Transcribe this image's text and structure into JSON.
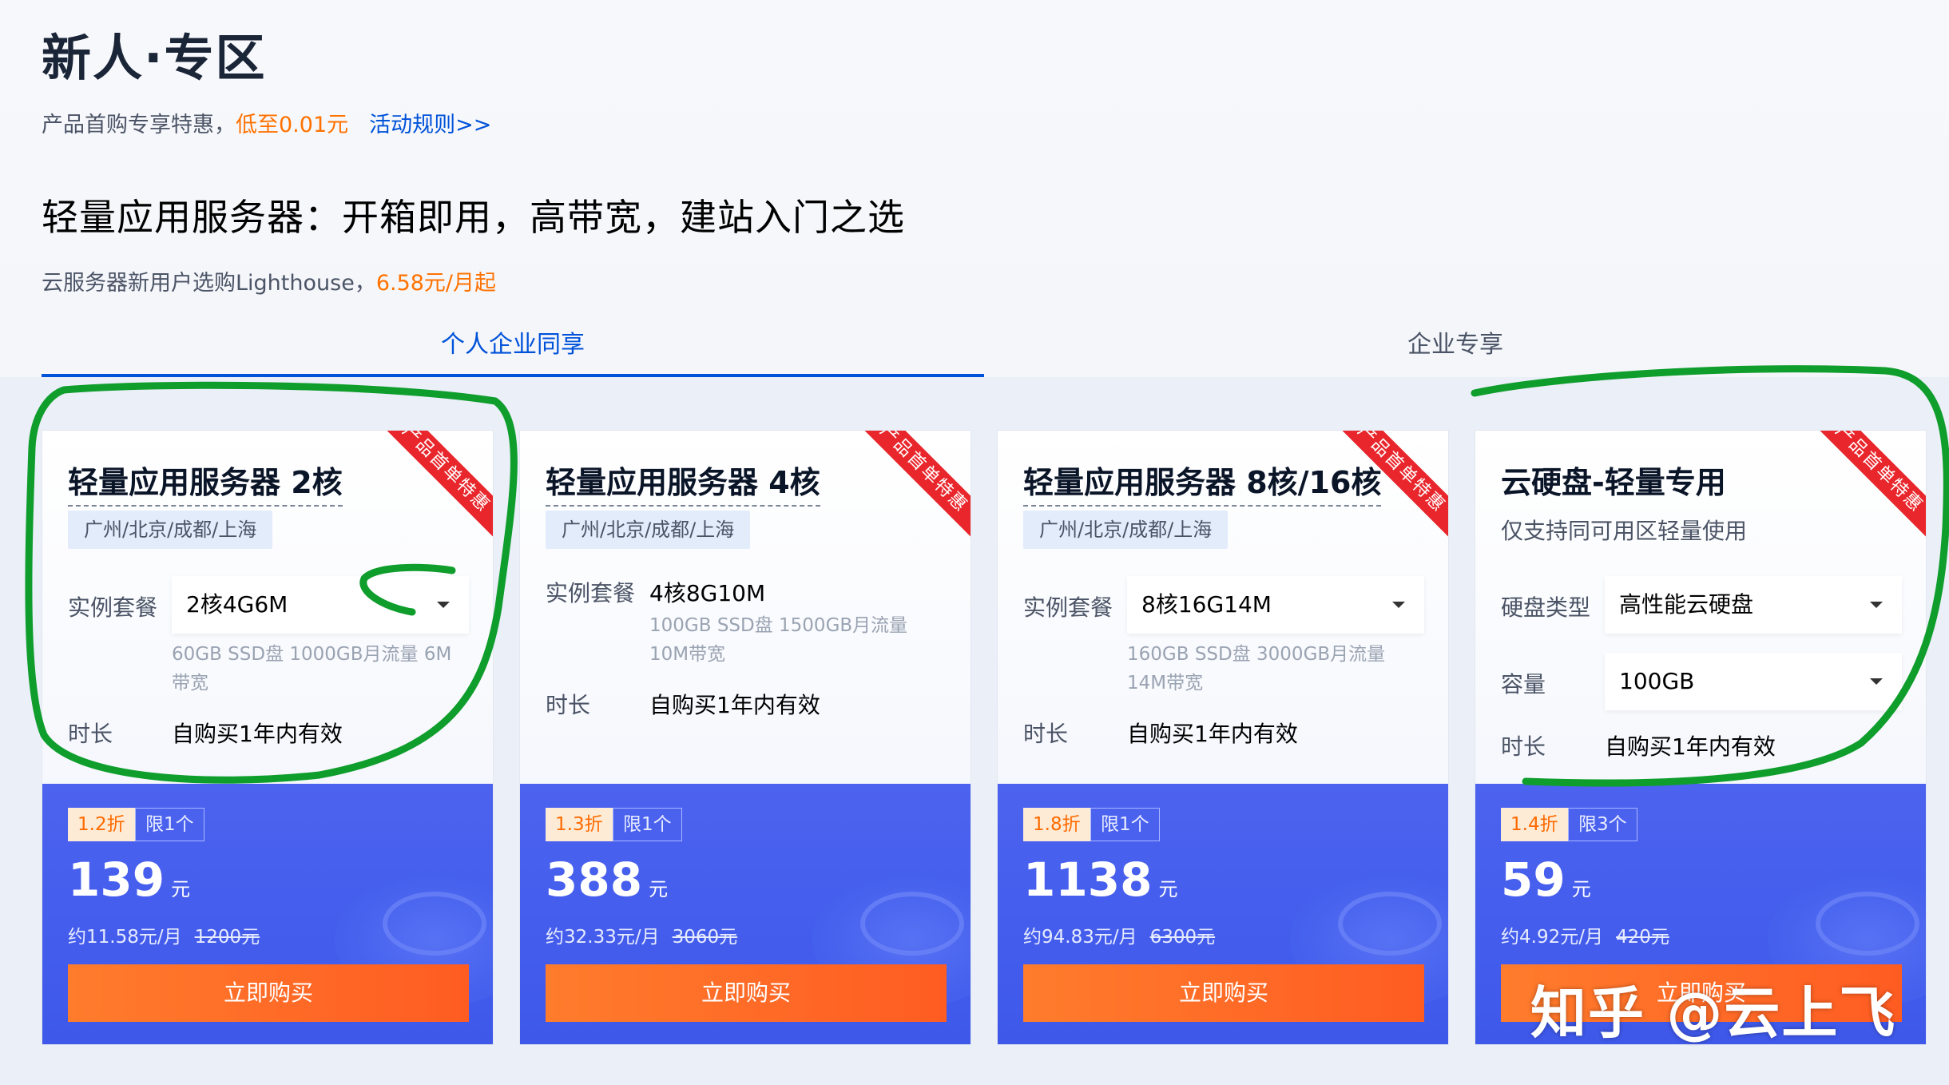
{
  "header": {
    "title": "新人·专区",
    "subtitle_prefix": "产品首购专享特惠，",
    "subtitle_highlight": "低至0.01元",
    "rules_link": "活动规则>>"
  },
  "promo": {
    "heading": "轻量应用服务器：开箱即用，高带宽，建站入门之选",
    "sub_prefix": "云服务器新用户选购Lighthouse，",
    "sub_highlight": "6.58元/月起"
  },
  "tabs": [
    {
      "label": "个人企业同享",
      "active": true
    },
    {
      "label": "企业专享",
      "active": false
    }
  ],
  "cards": [
    {
      "ribbon": "产品首单特惠",
      "title": "轻量应用服务器 2核",
      "region": "广州/北京/成都/上海",
      "package_label": "实例套餐",
      "package_value": "2核4G6M",
      "spec": "60GB SSD盘 1000GB月流量 6M带宽",
      "duration_label": "时长",
      "duration_value": "自购买1年内有效",
      "discount": "1.2折",
      "limit": "限1个",
      "price": "139",
      "price_unit": "元",
      "per_month": "约11.58元/月",
      "original": "1200元",
      "buy": "立即购买"
    },
    {
      "ribbon": "产品首单特惠",
      "title": "轻量应用服务器 4核",
      "region": "广州/北京/成都/上海",
      "package_label": "实例套餐",
      "package_value": "4核8G10M",
      "spec": "100GB SSD盘 1500GB月流量 10M带宽",
      "duration_label": "时长",
      "duration_value": "自购买1年内有效",
      "discount": "1.3折",
      "limit": "限1个",
      "price": "388",
      "price_unit": "元",
      "per_month": "约32.33元/月",
      "original": "3060元",
      "buy": "立即购买"
    },
    {
      "ribbon": "产品首单特惠",
      "title": "轻量应用服务器 8核/16核",
      "region": "广州/北京/成都/上海",
      "package_label": "实例套餐",
      "package_value": "8核16G14M",
      "spec": "160GB SSD盘 3000GB月流量 14M带宽",
      "duration_label": "时长",
      "duration_value": "自购买1年内有效",
      "discount": "1.8折",
      "limit": "限1个",
      "price": "1138",
      "price_unit": "元",
      "per_month": "约94.83元/月",
      "original": "6300元",
      "buy": "立即购买"
    },
    {
      "ribbon": "产品首单特惠",
      "title": "云硬盘-轻量专用",
      "desc": "仅支持同可用区轻量使用",
      "disk_type_label": "硬盘类型",
      "disk_type_value": "高性能云硬盘",
      "capacity_label": "容量",
      "capacity_value": "100GB",
      "duration_label": "时长",
      "duration_value": "自购买1年内有效",
      "discount": "1.4折",
      "limit": "限3个",
      "price": "59",
      "price_unit": "元",
      "per_month": "约4.92元/月",
      "original": "420元",
      "buy": "立即购买"
    }
  ],
  "watermark": "知乎 @云上飞",
  "colors": {
    "brand_blue": "#0052d9",
    "highlight_orange": "#ff7200",
    "price_panel": "#4a62ee",
    "buy_button": "#ff6a28",
    "ribbon_red": "#e8262b",
    "annotation_green": "#0f9d2c"
  }
}
